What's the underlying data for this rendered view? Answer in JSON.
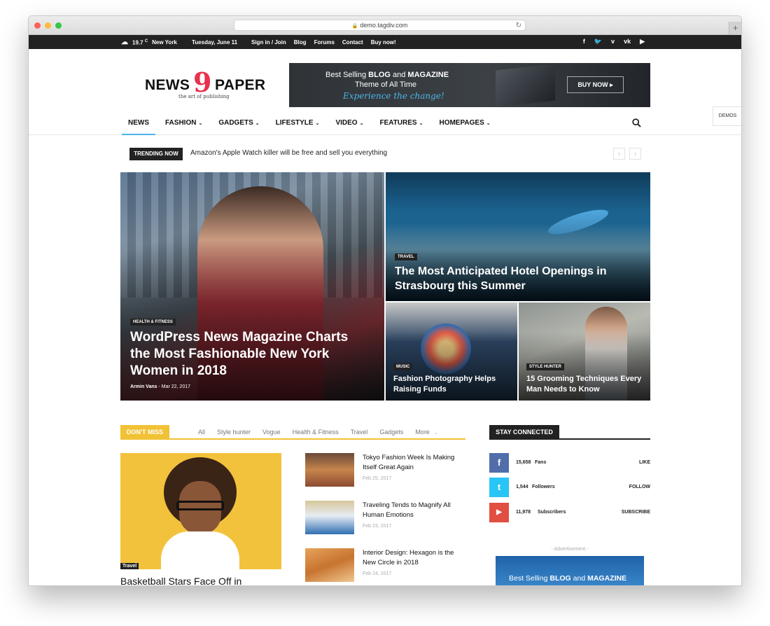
{
  "browser": {
    "url": "demo.tagdiv.com"
  },
  "topbar": {
    "temp": "19.7",
    "temp_unit": "C",
    "city": "New York",
    "date": "Tuesday, June 11",
    "links": [
      "Sign in / Join",
      "Blog",
      "Forums",
      "Contact",
      "Buy now!"
    ],
    "social": [
      "facebook-icon",
      "twitter-icon",
      "vimeo-icon",
      "vk-icon",
      "youtube-icon"
    ]
  },
  "logo": {
    "left": "NEWS",
    "nine": "9",
    "right": "PAPER",
    "tagline": "the art of publishing"
  },
  "ad_banner": {
    "line1_pre": "Best Selling ",
    "line1_b1": "BLOG",
    "line1_mid": " and ",
    "line1_b2": "MAGAZINE",
    "line2": "Theme of All Time",
    "line3": "Experience the change!",
    "button": "BUY NOW ▸"
  },
  "demos": "DEMOS",
  "nav": {
    "items": [
      "NEWS",
      "FASHION",
      "GADGETS",
      "LIFESTYLE",
      "VIDEO",
      "FEATURES",
      "HOMEPAGES"
    ]
  },
  "trending": {
    "badge": "TRENDING NOW",
    "headline": "Amazon's Apple Watch killer will be free and sell you everything"
  },
  "featured": [
    {
      "category": "HEALTH & FITNESS",
      "title": "WordPress News Magazine Charts the Most Fashionable New York Women in 2018",
      "author": "Armin Vans",
      "date": "Mar 22, 2017"
    },
    {
      "category": "TRAVEL",
      "title": "The Most Anticipated Hotel Openings in Strasbourg this Summer"
    },
    {
      "category": "MUSIC",
      "title": "Fashion Photography Helps Raising Funds"
    },
    {
      "category": "STYLE HUNTER",
      "title": "15 Grooming Techniques Every Man Needs to Know"
    }
  ],
  "dont_miss": {
    "label": "DON'T MISS",
    "tabs": [
      "All",
      "Style hunter",
      "Vogue",
      "Health & Fitness",
      "Travel",
      "Gadgets",
      "More"
    ],
    "main": {
      "category": "Travel",
      "title": "Basketball Stars Face Off in"
    },
    "list": [
      {
        "title": "Tokyo Fashion Week Is Making Itself Great Again",
        "date": "Feb 25, 2017"
      },
      {
        "title": "Traveling Tends to Magnify All Human Emotions",
        "date": "Feb 23, 2017"
      },
      {
        "title": "Interior Design: Hexagon is the New Circle in 2018",
        "date": "Feb 24, 2017"
      }
    ]
  },
  "stay_connected": {
    "label": "STAY CONNECTED",
    "rows": [
      {
        "icon": "facebook-icon",
        "glyph": "f",
        "count": "15,658",
        "unit": "Fans",
        "action": "LIKE"
      },
      {
        "icon": "twitter-icon",
        "glyph": "t",
        "count": "1,544",
        "unit": "Followers",
        "action": "FOLLOW"
      },
      {
        "icon": "youtube-icon",
        "glyph": "▶",
        "count": "11,978",
        "unit": "Subscribers",
        "action": "SUBSCRIBE"
      }
    ]
  },
  "advertisement": {
    "label": "- Advertisement -",
    "text_pre": "Best Selling ",
    "text_b1": "BLOG",
    "text_mid": " and ",
    "text_b2": "MAGAZINE"
  }
}
